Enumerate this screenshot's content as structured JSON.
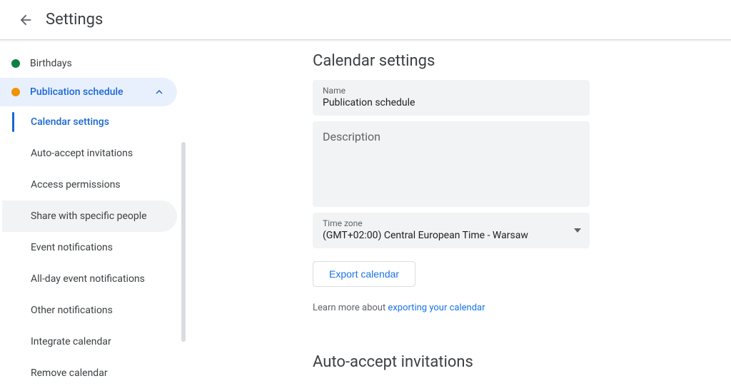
{
  "header": {
    "title": "Settings"
  },
  "sidebar": {
    "calendars": [
      {
        "label": "Birthdays",
        "dotColor": "#0b8043"
      },
      {
        "label": "Publication schedule",
        "dotColor": "#f09300"
      }
    ],
    "subitems": [
      "Calendar settings",
      "Auto-accept invitations",
      "Access permissions",
      "Share with specific people",
      "Event notifications",
      "All-day event notifications",
      "Other notifications",
      "Integrate calendar",
      "Remove calendar"
    ]
  },
  "main": {
    "section1_title": "Calendar settings",
    "name_label": "Name",
    "name_value": "Publication schedule",
    "description_label": "Description",
    "tz_label": "Time zone",
    "tz_value": "(GMT+02:00) Central European Time - Warsaw",
    "export_label": "Export calendar",
    "learn_prefix": "Learn more about ",
    "learn_link": "exporting your calendar",
    "section2_title": "Auto-accept invitations"
  }
}
